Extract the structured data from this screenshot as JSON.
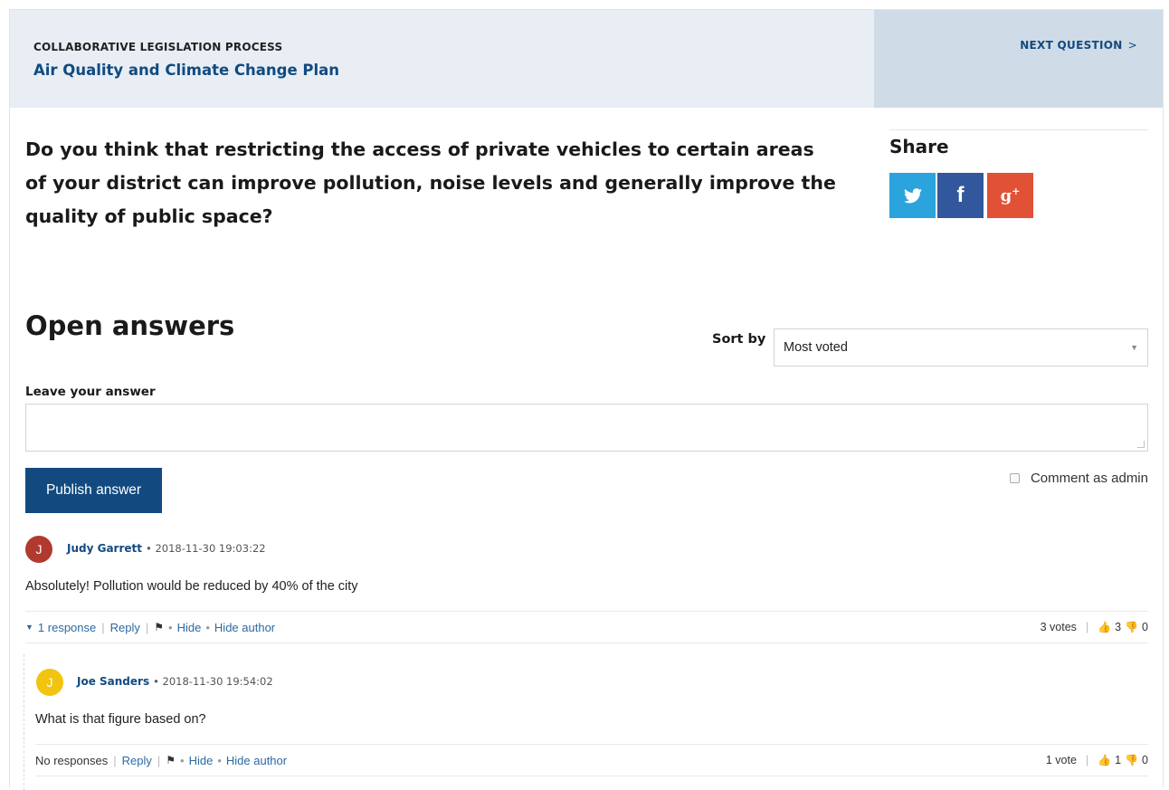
{
  "header": {
    "kicker": "COLLABORATIVE LEGISLATION PROCESS",
    "title": "Air Quality and Climate Change Plan",
    "next_label": "NEXT QUESTION",
    "next_chevron": ">"
  },
  "question": "Do you think that restricting the access of private vehicles to certain areas of your district can improve pollution, noise levels and generally improve the quality of public space?",
  "share": {
    "title": "Share",
    "twitter_glyph": "t",
    "facebook_glyph": "f",
    "google_glyph": "g",
    "google_sup": "+",
    "colors": {
      "twitter": "#2ba3dc",
      "facebook": "#33579c",
      "google": "#e05135"
    }
  },
  "answers_section": {
    "title": "Open answers",
    "sort_label": "Sort by",
    "sort_value": "Most voted",
    "leave_label": "Leave your answer",
    "answer_value": "",
    "publish_label": "Publish answer",
    "admin_label": "Comment as admin"
  },
  "comments": [
    {
      "initial": "J",
      "avatar_color": "#b03a2e",
      "author": "Judy Garrett",
      "timestamp": "• 2018-11-30 19:03:22",
      "text": "Absolutely! Pollution would be reduced by 40% of the city",
      "responses": "1 response",
      "reply": "Reply",
      "hide": "Hide",
      "hide_author": "Hide author",
      "votes_label": "3 votes",
      "up": "3",
      "down": "0"
    },
    {
      "initial": "J",
      "avatar_color": "#f1c40f",
      "author": "Joe Sanders",
      "timestamp": "• 2018-11-30 19:54:02",
      "text": "What is that figure based on?",
      "responses": "No responses",
      "reply": "Reply",
      "hide": "Hide",
      "hide_author": "Hide author",
      "votes_label": "1 vote",
      "up": "1",
      "down": "0"
    }
  ],
  "brand_color": "#124a80"
}
